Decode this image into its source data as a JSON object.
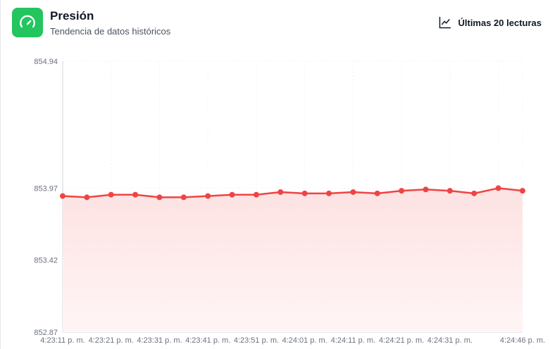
{
  "header": {
    "title": "Presión",
    "subtitle": "Tendencia de datos históricos",
    "range_label": "Últimas 20 lecturas",
    "icon": "gauge-icon",
    "range_icon": "line-chart-icon",
    "accent_color": "#22c55e"
  },
  "chart_data": {
    "type": "area",
    "title": "",
    "xlabel": "",
    "ylabel": "",
    "ylim": [
      852.87,
      854.94
    ],
    "y_ticks": [
      "852.87",
      "853.42",
      "853.97",
      "854.94"
    ],
    "x_tick_labels": [
      "4:23:11 p. m.",
      "4:23:21 p. m.",
      "4:23:31 p. m.",
      "4:23:41 p. m.",
      "4:23:51 p. m.",
      "4:24:01 p. m.",
      "4:24:11 p. m.",
      "4:24:21 p. m.",
      "4:24:31 p. m.",
      "4:24:46 p. m."
    ],
    "x": [
      "4:23:11 p. m.",
      "4:23:16 p. m.",
      "4:23:21 p. m.",
      "4:23:26 p. m.",
      "4:23:31 p. m.",
      "4:23:36 p. m.",
      "4:23:41 p. m.",
      "4:23:46 p. m.",
      "4:23:51 p. m.",
      "4:23:56 p. m.",
      "4:24:01 p. m.",
      "4:24:06 p. m.",
      "4:24:11 p. m.",
      "4:24:16 p. m.",
      "4:24:21 p. m.",
      "4:24:26 p. m.",
      "4:24:31 p. m.",
      "4:24:36 p. m.",
      "4:24:41 p. m.",
      "4:24:46 p. m."
    ],
    "series": [
      {
        "values": [
          853.91,
          853.9,
          853.92,
          853.92,
          853.9,
          853.9,
          853.91,
          853.92,
          853.92,
          853.94,
          853.93,
          853.93,
          853.94,
          853.93,
          853.95,
          853.96,
          853.95,
          853.93,
          853.97,
          853.95
        ],
        "color": "#ef4444",
        "fill_color": "#fde2e2"
      }
    ],
    "grid": true
  }
}
